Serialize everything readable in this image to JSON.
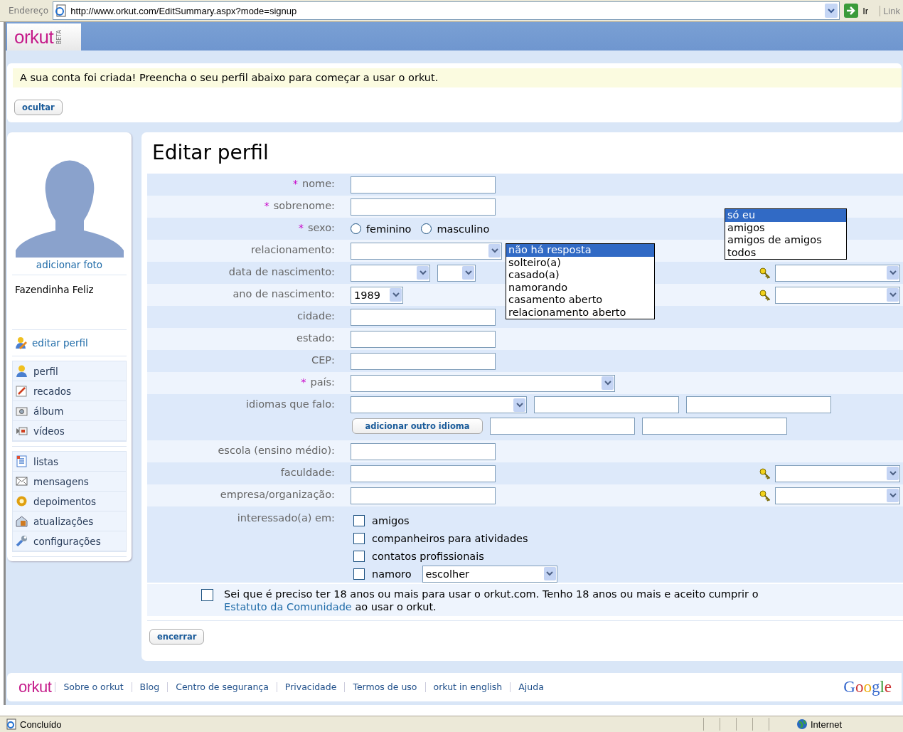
{
  "browser": {
    "address_label": "Endereço",
    "url": "http://www.orkut.com/EditSummary.aspx?mode=signup",
    "go_label": "Ir",
    "links_label": "Link"
  },
  "header": {
    "logo": "orkut",
    "beta": "BETA"
  },
  "notice": {
    "message": "A sua conta foi criada! Preencha o seu perfil abaixo para começar a usar o orkut.",
    "hide_button": "ocultar"
  },
  "sidebar": {
    "add_photo": "adicionar foto",
    "name": "Fazendinha Feliz",
    "edit_profile": "editar perfil",
    "groups": [
      [
        {
          "label": "perfil",
          "kind": "person"
        },
        {
          "label": "recados",
          "kind": "note"
        },
        {
          "label": "álbum",
          "kind": "camera"
        },
        {
          "label": "vídeos",
          "kind": "video"
        }
      ],
      [
        {
          "label": "listas",
          "kind": "list"
        },
        {
          "label": "mensagens",
          "kind": "mail"
        },
        {
          "label": "depoimentos",
          "kind": "gear"
        },
        {
          "label": "atualizações",
          "kind": "updates"
        },
        {
          "label": "configurações",
          "kind": "wrench"
        }
      ]
    ]
  },
  "form": {
    "title": "Editar perfil",
    "rows": [
      {
        "kind": "text",
        "label": "nome:",
        "marker": "*",
        "privacy": false
      },
      {
        "kind": "text",
        "label": "sobrenome:",
        "marker": "*",
        "privacy": false
      },
      {
        "kind": "radio",
        "label": "sexo:",
        "marker": "*",
        "privacy": false,
        "options": [
          {
            "label": "feminino",
            "selected": false
          },
          {
            "label": "masculino",
            "selected": false
          }
        ]
      },
      {
        "kind": "select",
        "label": "relacionamento:",
        "privacy": false
      },
      {
        "kind": "date",
        "label": "data de nascimento:",
        "privacy": true
      },
      {
        "kind": "year",
        "label": "ano de nascimento:",
        "privacy": true,
        "value": "1989"
      },
      {
        "kind": "text",
        "label": "cidade:",
        "privacy": false
      },
      {
        "kind": "text",
        "label": "estado:",
        "privacy": false
      },
      {
        "kind": "text",
        "label": "CEP:",
        "privacy": false
      },
      {
        "kind": "wide_select",
        "label": "país:",
        "marker": "*",
        "privacy": false
      },
      {
        "kind": "languages",
        "label": "idiomas que falo:",
        "privacy": false,
        "button": "adicionar outro idioma"
      },
      {
        "kind": "text",
        "label": "escola (ensino médio):",
        "privacy": false
      },
      {
        "kind": "text",
        "label": "faculdade:",
        "privacy": true
      },
      {
        "kind": "text",
        "label": "empresa/organização:",
        "privacy": true
      },
      {
        "kind": "interests",
        "label": "interessado(a) em:",
        "privacy": false,
        "options": [
          {
            "label": "amigos",
            "checked": false
          },
          {
            "label": "companheiros para atividades",
            "checked": false
          },
          {
            "label": "contatos profissionais",
            "checked": false
          },
          {
            "label": "namoro",
            "checked": false,
            "select": "escolher"
          }
        ]
      }
    ],
    "relationship_options": [
      {
        "label": "não há resposta",
        "selected": true
      },
      {
        "label": "solteiro(a)",
        "selected": false
      },
      {
        "label": "casado(a)",
        "selected": false
      },
      {
        "label": "namorando",
        "selected": false
      },
      {
        "label": "casamento aberto",
        "selected": false
      },
      {
        "label": "relacionamento aberto",
        "selected": false
      }
    ],
    "privacy_options": [
      {
        "label": "só eu",
        "selected": true
      },
      {
        "label": "amigos",
        "selected": false
      },
      {
        "label": "amigos de amigos",
        "selected": false
      },
      {
        "label": "todos",
        "selected": false
      }
    ],
    "agreement": {
      "checked": false,
      "text_before": "Sei que é preciso ter 18 anos ou mais para usar o orkut.com. Tenho 18 anos ou mais e aceito cumprir o",
      "link": "Estatuto da Comunidade",
      "text_after": "ao usar o orkut."
    },
    "finish_button": "encerrar"
  },
  "footer": {
    "logo": "orkut",
    "links": [
      "Sobre o orkut",
      "Blog",
      "Centro de segurança",
      "Privacidade",
      "Termos de uso",
      "orkut in english",
      "Ajuda"
    ],
    "brand": "Google"
  },
  "status_bar": {
    "text": "Concluído",
    "zone": "Internet"
  }
}
